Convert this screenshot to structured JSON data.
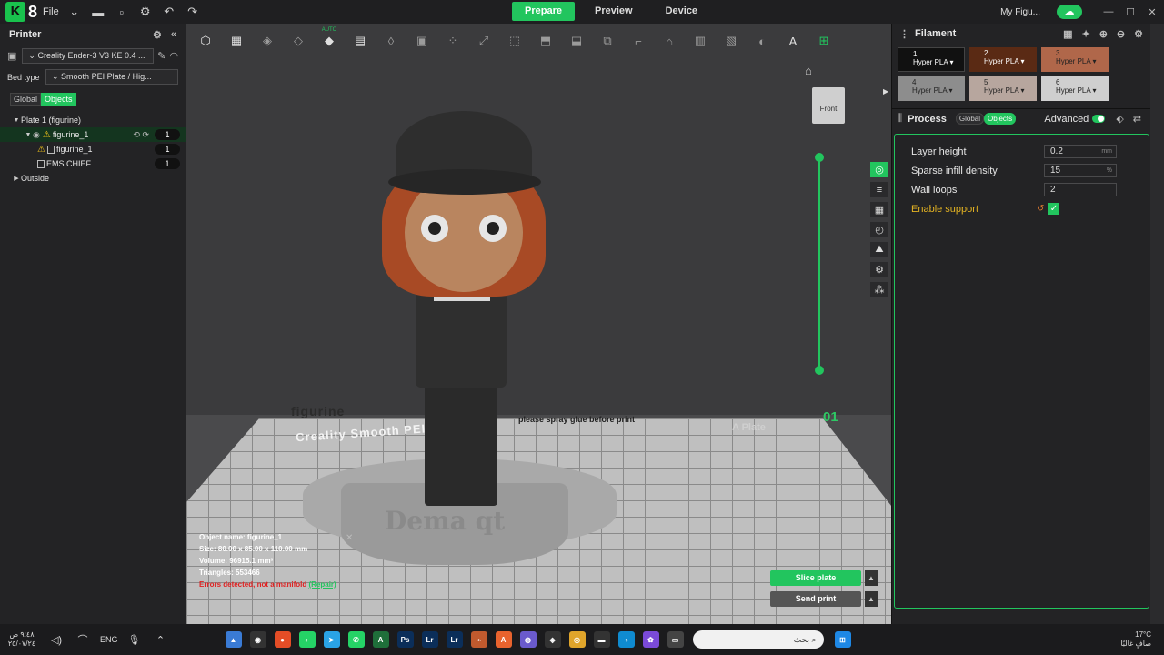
{
  "topbar": {
    "logo_letter": "K",
    "logo_num": "8",
    "file_label": "File",
    "tabs": [
      {
        "label": "Prepare"
      },
      {
        "label": "Preview"
      },
      {
        "label": "Device"
      }
    ],
    "project_name": "My Figu...",
    "icons": [
      "folder-icon",
      "save-icon",
      "gear-icon",
      "undo-icon",
      "redo-icon",
      "cloud-upload-icon",
      "minimize-icon",
      "maximize-icon",
      "close-icon"
    ]
  },
  "left": {
    "title": "Printer",
    "printer_name": "Creality Ender-3 V3 KE 0.4 ...",
    "bed_type_label": "Bed type",
    "bed_type_value": "Smooth PEI Plate / Hig...",
    "toggle_global": "Global",
    "toggle_objects": "Objects",
    "tree": [
      {
        "label": "Plate 1 (figurine)",
        "count": ""
      },
      {
        "label": "figurine_1",
        "count": "1"
      },
      {
        "label": "figurine_1",
        "count": "1"
      },
      {
        "label": "EMS CHIEF",
        "count": "1"
      },
      {
        "label": "Outside",
        "count": ""
      }
    ]
  },
  "viewport": {
    "auto_label": "AUTO",
    "view_cube_label": "Front",
    "bed_name": "Creality Smooth PEI Plate",
    "bed_tag": "figurine",
    "bed_note": "please spray glue before print",
    "plate_number": "01",
    "plate_label": "A Plate",
    "base_text": "Dema qt",
    "figure_tag": "EMS CHIEF",
    "object_info": {
      "name": "Object name: figurine_1",
      "size": "Size: 80.00 x 85.00 x 110.00 mm",
      "volume": "Volume: 96915.1 mm³",
      "triangles": "Triangles: 553466",
      "error": "Errors detected, not a manifold",
      "repair": "(Repair)"
    },
    "slice_label": "Slice plate",
    "send_label": "Send print"
  },
  "right": {
    "filament_title": "Filament",
    "filaments": [
      {
        "num": "1",
        "type": "Hyper PLA",
        "color": "#111111"
      },
      {
        "num": "2",
        "type": "Hyper PLA",
        "color": "#5a2a14"
      },
      {
        "num": "3",
        "type": "Hyper PLA",
        "color": "#b0674a"
      },
      {
        "num": "4",
        "type": "Hyper PLA",
        "color": "#8d8d8d"
      },
      {
        "num": "5",
        "type": "Hyper PLA",
        "color": "#b7a69e"
      },
      {
        "num": "6",
        "type": "Hyper PLA",
        "color": "#cfcfcf"
      }
    ],
    "process_title": "Process",
    "toggle_global": "Global",
    "toggle_objects": "Objects",
    "advanced_label": "Advanced",
    "settings": [
      {
        "label": "Layer height",
        "value": "0.2",
        "unit": "mm"
      },
      {
        "label": "Sparse infill density",
        "value": "15",
        "unit": "%"
      },
      {
        "label": "Wall loops",
        "value": "2",
        "unit": ""
      },
      {
        "label": "Enable support",
        "value": "✓",
        "unit": ""
      }
    ]
  },
  "taskbar": {
    "time": "٩:٤٨ ص",
    "date": "٢٥/٠٧/٢٤",
    "lang": "ENG",
    "search_placeholder": "بحث",
    "weather_temp": "17°C",
    "weather_text": "صافٍ غالبًا"
  },
  "colors": {
    "accent": "#22c55e",
    "warning": "#f5c518",
    "error": "#e02020"
  }
}
